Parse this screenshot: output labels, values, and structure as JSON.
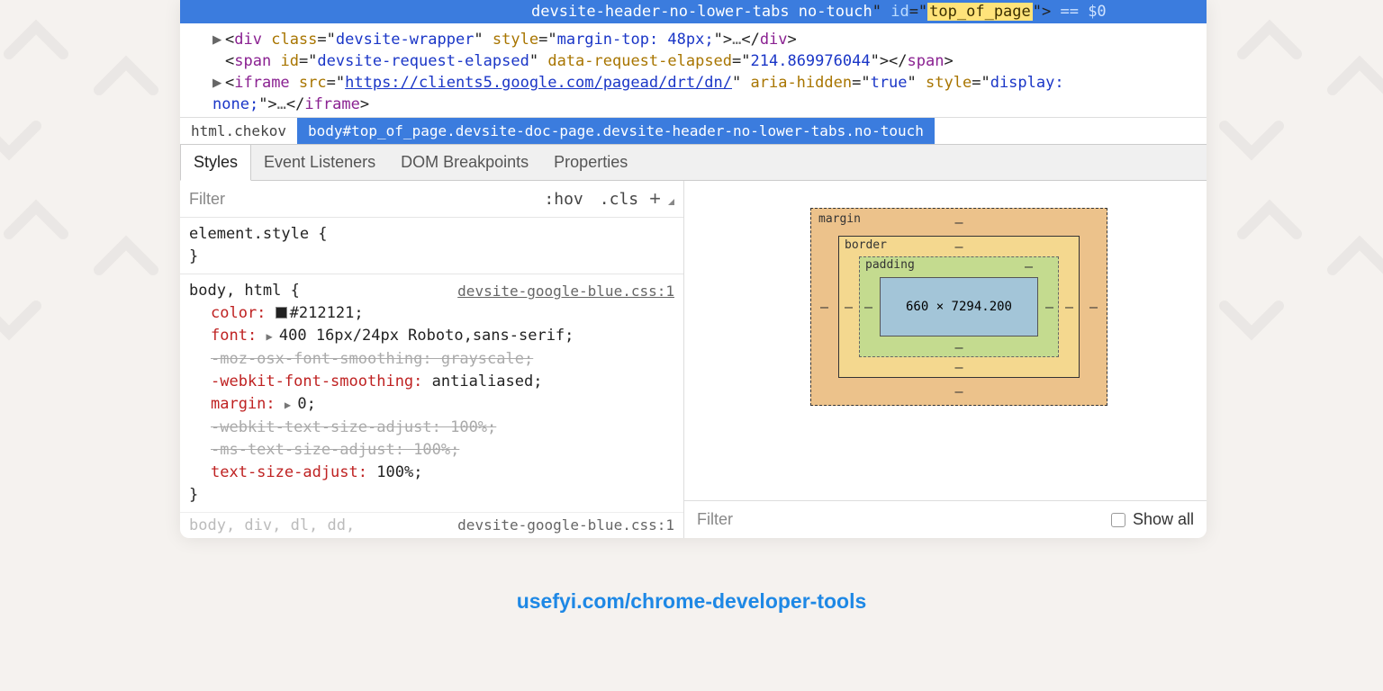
{
  "dom": {
    "highlighted_prefix": "devsite-header-no-lower-tabs no-touch",
    "highlighted_id_attr": "id",
    "highlighted_id_val": "top_of_page",
    "highlighted_trail": " == $0",
    "line1": {
      "tag": "div",
      "attrs": [
        [
          "class",
          "devsite-wrapper"
        ],
        [
          "style",
          "margin-top: 48px;"
        ]
      ]
    },
    "line2": {
      "tag": "span",
      "attrs": [
        [
          "id",
          "devsite-request-elapsed"
        ],
        [
          "data-request-elapsed",
          "214.869976044"
        ]
      ]
    },
    "line3": {
      "tag": "iframe",
      "src": "https://clients5.google.com/pagead/drt/dn/",
      "attrs_after": [
        [
          "aria-hidden",
          "true"
        ],
        [
          "style",
          "display:"
        ]
      ],
      "style_cont": "none;"
    }
  },
  "crumbs": {
    "a": "html.chekov",
    "b": "body#top_of_page.devsite-doc-page.devsite-header-no-lower-tabs.no-touch"
  },
  "tabs": [
    "Styles",
    "Event Listeners",
    "DOM Breakpoints",
    "Properties"
  ],
  "filter": {
    "placeholder": "Filter",
    "hov": ":hov",
    "cls": ".cls"
  },
  "element_style": {
    "selector": "element.style {",
    "close": "}"
  },
  "rule1": {
    "selector": "body, html {",
    "source": "devsite-google-blue.css:1",
    "color_prop": "color:",
    "color_val": "#212121;",
    "font_prop": "font:",
    "font_val": "400 16px/24px Roboto,sans-serif;",
    "moz": "-moz-osx-font-smoothing: grayscale;",
    "webkit_fs_prop": "-webkit-font-smoothing:",
    "webkit_fs_val": "antialiased;",
    "margin_prop": "margin:",
    "margin_val": "0;",
    "webkit_tsa": "-webkit-text-size-adjust: 100%;",
    "ms_tsa": "-ms-text-size-adjust: 100%;",
    "tsa_prop": "text-size-adjust:",
    "tsa_val": "100%;",
    "close": "}"
  },
  "next_rule": {
    "selectors": "body, div, dl, dd,",
    "source": "devsite-google-blue.css:1"
  },
  "boxmodel": {
    "margin": "margin",
    "border": "border",
    "padding": "padding",
    "content": "660 × 7294.200",
    "dash": "–"
  },
  "right_filter": {
    "placeholder": "Filter",
    "show_all": "Show all"
  },
  "credit": "usefyi.com/chrome-developer-tools"
}
